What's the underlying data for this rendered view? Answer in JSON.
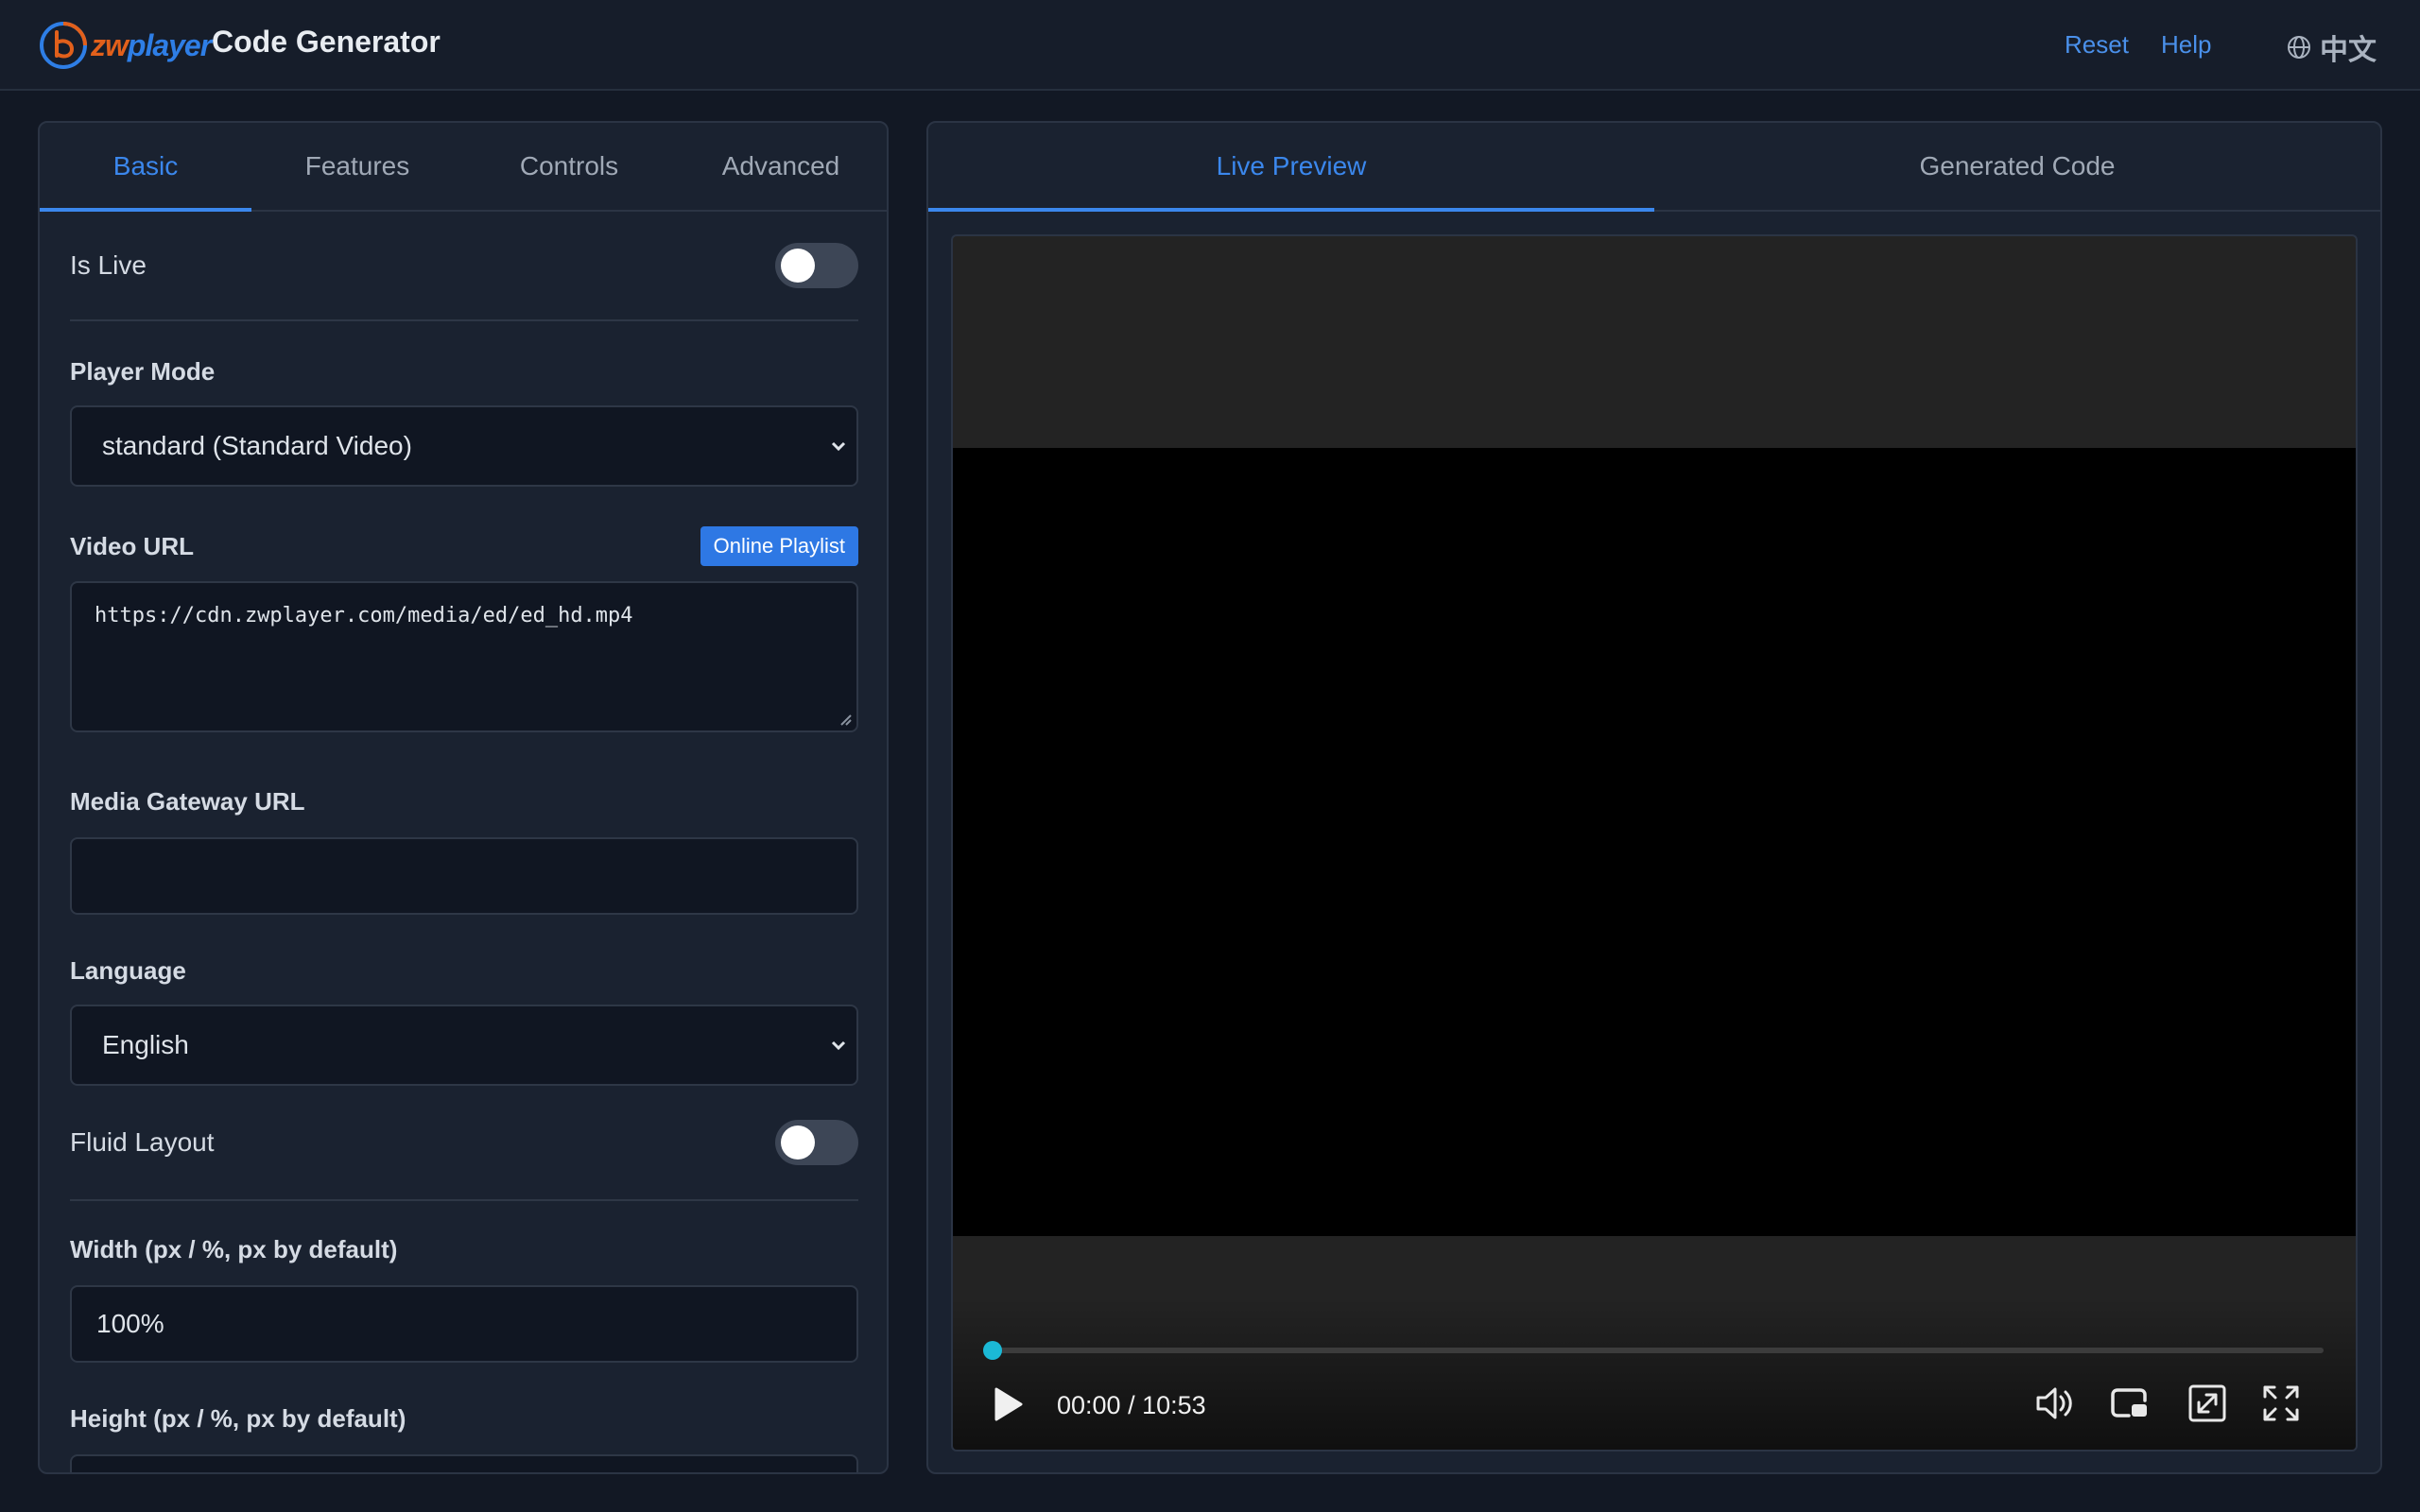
{
  "header": {
    "logo_text_a": "zw",
    "logo_text_b": "player",
    "title": "Code Generator",
    "reset": "Reset",
    "help": "Help",
    "language_switch": "中文",
    "accent": "#3b87ec"
  },
  "left_tabs": [
    {
      "label": "Basic",
      "active": true
    },
    {
      "label": "Features",
      "active": false
    },
    {
      "label": "Controls",
      "active": false
    },
    {
      "label": "Advanced",
      "active": false
    }
  ],
  "form": {
    "is_live": {
      "label": "Is Live",
      "on": false
    },
    "player_mode": {
      "label": "Player Mode",
      "value": "standard (Standard Video)"
    },
    "video_url": {
      "label": "Video URL",
      "button": "Online Playlist",
      "value": "https://cdn.zwplayer.com/media/ed/ed_hd.mp4"
    },
    "media_gateway": {
      "label": "Media Gateway URL",
      "value": ""
    },
    "language": {
      "label": "Language",
      "value": "English"
    },
    "fluid_layout": {
      "label": "Fluid Layout",
      "on": false
    },
    "width": {
      "label": "Width (px / %, px by default)",
      "value": "100%"
    },
    "height": {
      "label": "Height (px / %, px by default)",
      "value": ""
    }
  },
  "right_tabs": [
    {
      "label": "Live Preview",
      "active": true
    },
    {
      "label": "Generated Code",
      "active": false
    }
  ],
  "player": {
    "time_display": "00:00 / 10:53",
    "progress": 0,
    "progress_color": "#1bb9d6"
  }
}
